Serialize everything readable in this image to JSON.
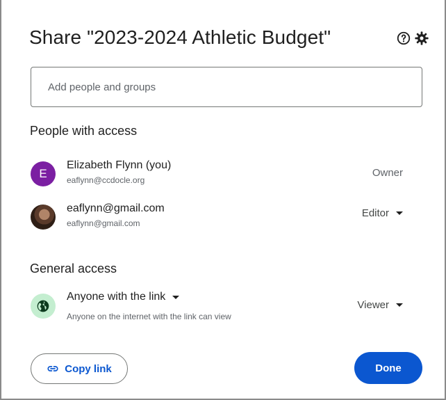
{
  "dialog": {
    "title": "Share \"2023-2024 Athletic Budget\"",
    "help_icon": "help-circle-icon",
    "settings_icon": "gear-icon"
  },
  "add_people": {
    "value": "",
    "placeholder": "Add people and groups"
  },
  "people_section": {
    "title": "People with access",
    "people": [
      {
        "name": "Elizabeth Flynn (you)",
        "email": "eaflynn@ccdocle.org",
        "avatar_letter": "E",
        "avatar_color": "#7b1fa2",
        "role": "Owner"
      },
      {
        "name": "eaflynn@gmail.com",
        "email": "eaflynn@gmail.com",
        "avatar_type": "photo",
        "role": "Editor"
      }
    ]
  },
  "general_section": {
    "title": "General access",
    "access_option": "Anyone with the link",
    "access_description": "Anyone on the internet with the link can view",
    "access_icon": "globe-icon",
    "role": "Viewer"
  },
  "footer": {
    "copy_link_label": "Copy link",
    "copy_link_icon": "link-icon",
    "done_label": "Done"
  },
  "colors": {
    "primary": "#0b57d0",
    "globe_bg": "#c4eed0",
    "owner_avatar": "#7b1fa2"
  }
}
